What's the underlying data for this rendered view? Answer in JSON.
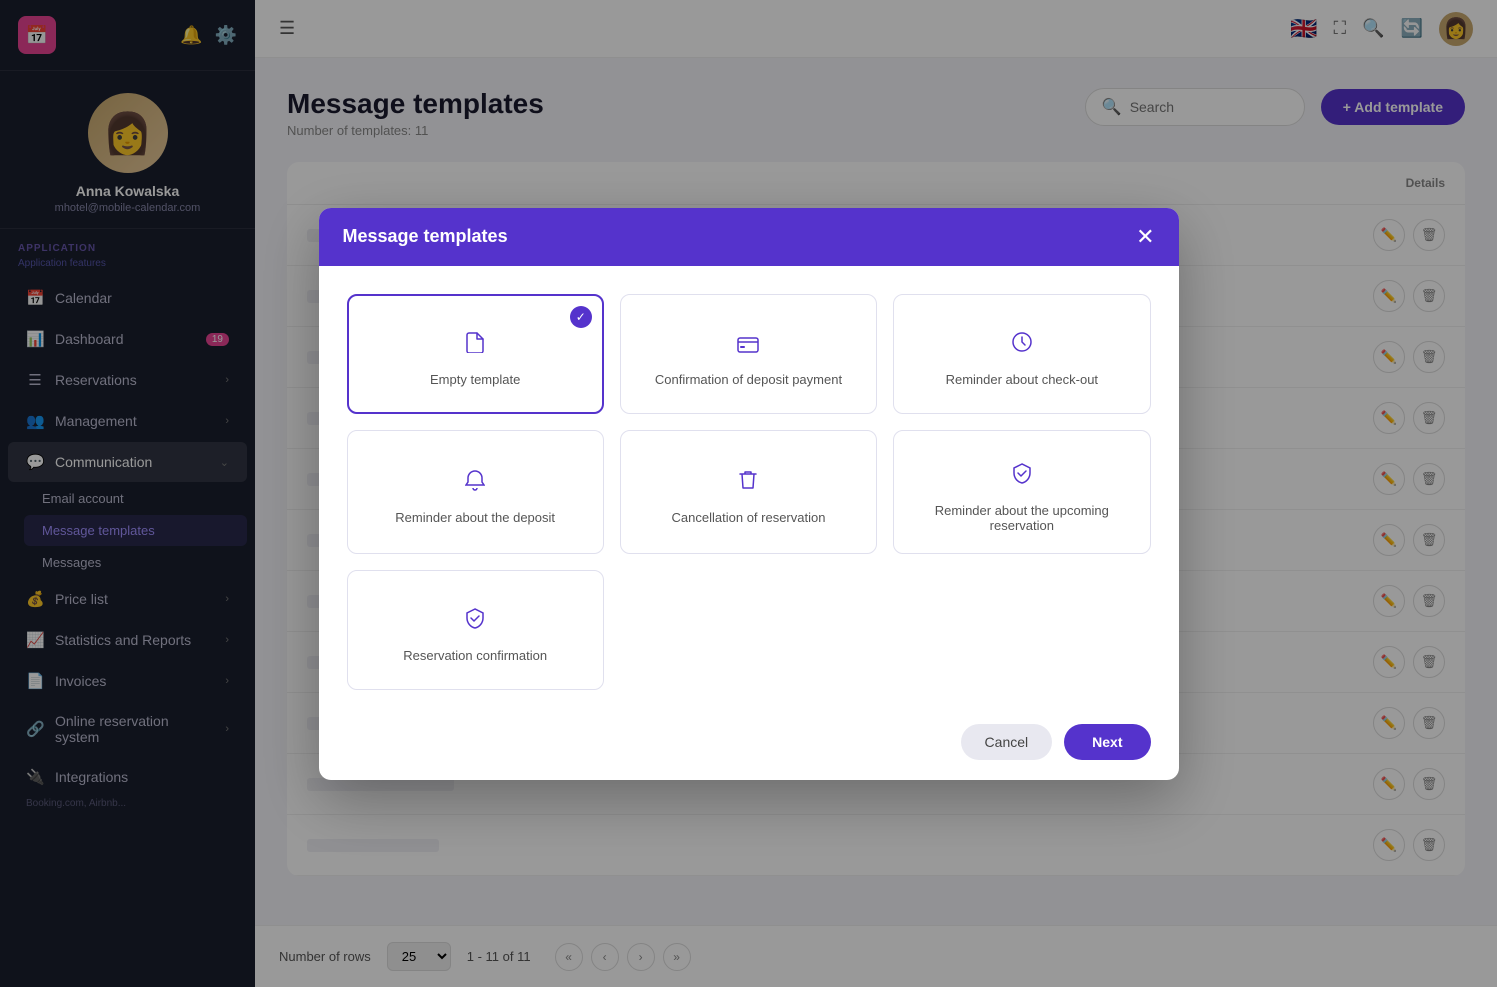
{
  "sidebar": {
    "logo_text": "📅",
    "profile": {
      "name": "Anna Kowalska",
      "email": "mhotel@mobile-calendar.com"
    },
    "section_label": "APPLICATION",
    "section_sublabel": "Application features",
    "nav_items": [
      {
        "id": "calendar",
        "label": "Calendar",
        "icon": "📅",
        "badge": null,
        "has_arrow": false
      },
      {
        "id": "dashboard",
        "label": "Dashboard",
        "icon": "📊",
        "badge": "19",
        "has_arrow": false
      },
      {
        "id": "reservations",
        "label": "Reservations",
        "icon": "☰",
        "badge": null,
        "has_arrow": true
      },
      {
        "id": "management",
        "label": "Management",
        "icon": "👥",
        "badge": null,
        "has_arrow": true
      },
      {
        "id": "communication",
        "label": "Communication",
        "icon": "💬",
        "badge": null,
        "has_arrow": true
      },
      {
        "id": "price-list",
        "label": "Price list",
        "icon": "💰",
        "badge": null,
        "has_arrow": true
      },
      {
        "id": "statistics",
        "label": "Statistics and Reports",
        "icon": "📈",
        "badge": null,
        "has_arrow": true
      },
      {
        "id": "invoices",
        "label": "Invoices",
        "icon": "📄",
        "badge": null,
        "has_arrow": true
      },
      {
        "id": "online-reservation",
        "label": "Online reservation system",
        "icon": "🔗",
        "badge": null,
        "has_arrow": true
      },
      {
        "id": "integrations",
        "label": "Integrations",
        "icon": "🔌",
        "badge": null,
        "has_arrow": false
      }
    ],
    "sub_items": [
      {
        "id": "email-account",
        "label": "Email account"
      },
      {
        "id": "message-templates",
        "label": "Message templates",
        "active": true
      },
      {
        "id": "messages",
        "label": "Messages"
      }
    ],
    "integrations_sublabel": "Booking.com, Airbnb..."
  },
  "page": {
    "title": "Message templates",
    "subtitle": "Number of templates: 11",
    "search_placeholder": "Search",
    "add_button_label": "+ Add template"
  },
  "table": {
    "header": {
      "details_label": "Details"
    },
    "rows": 11
  },
  "bottom_bar": {
    "rows_label": "Number of rows",
    "rows_value": "25",
    "pagination": "1 - 11 of 11"
  },
  "modal": {
    "title": "Message templates",
    "templates": [
      {
        "id": "empty",
        "label": "Empty template",
        "icon": "📄",
        "icon_type": "file",
        "selected": true
      },
      {
        "id": "deposit-confirmation",
        "label": "Confirmation of deposit payment",
        "icon": "💳",
        "icon_type": "card"
      },
      {
        "id": "checkout-reminder",
        "label": "Reminder about check-out",
        "icon": "🕐",
        "icon_type": "clock"
      },
      {
        "id": "deposit-reminder",
        "label": "Reminder about the deposit",
        "icon": "🔔",
        "icon_type": "bell"
      },
      {
        "id": "cancellation",
        "label": "Cancellation of reservation",
        "icon": "🗑",
        "icon_type": "trash"
      },
      {
        "id": "upcoming-reminder",
        "label": "Reminder about the upcoming reservation",
        "icon": "✅",
        "icon_type": "shield-check"
      },
      {
        "id": "reservation-confirmation",
        "label": "Reservation confirmation",
        "icon": "✅",
        "icon_type": "check-shield"
      }
    ],
    "cancel_label": "Cancel",
    "next_label": "Next"
  }
}
